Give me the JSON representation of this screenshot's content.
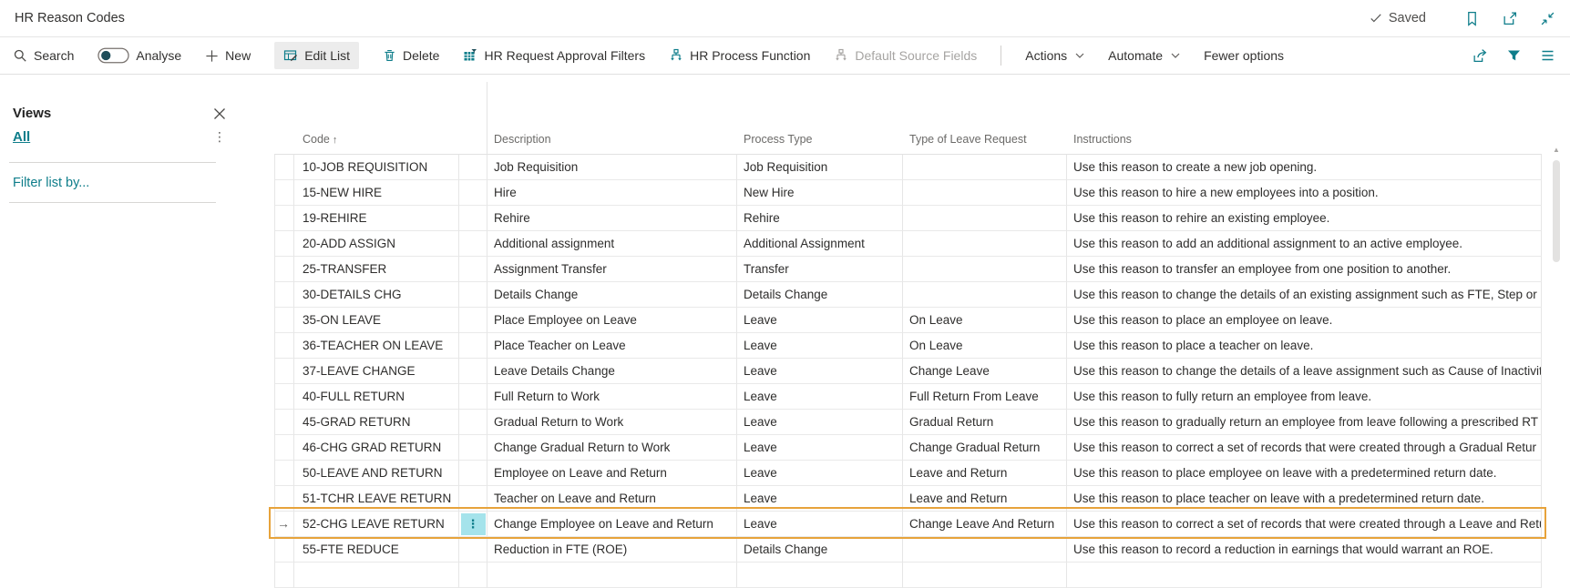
{
  "title_bar": {
    "title": "HR Reason Codes",
    "saved_label": "Saved"
  },
  "toolbar": {
    "search_label": "Search",
    "analyse_label": "Analyse",
    "new_label": "New",
    "edit_list_label": "Edit List",
    "delete_label": "Delete",
    "hr_request_approval_filters_label": "HR Request Approval Filters",
    "hr_process_function_label": "HR Process Function",
    "default_source_fields_label": "Default Source Fields",
    "actions_label": "Actions",
    "automate_label": "Automate",
    "fewer_options_label": "Fewer options"
  },
  "sidebar": {
    "views_label": "Views",
    "all_label": "All",
    "filter_label": "Filter list by..."
  },
  "grid": {
    "columns": [
      "Code",
      "Description",
      "Process Type",
      "Type of Leave Request",
      "Instructions"
    ],
    "sort_indicator": "↑",
    "selected_index": 14,
    "rows": [
      {
        "code": "10-JOB REQUISITION",
        "description": "Job Requisition",
        "process_type": "Job Requisition",
        "leave_type": "",
        "instructions": "Use this reason to create a new job opening."
      },
      {
        "code": "15-NEW HIRE",
        "description": "Hire",
        "process_type": "New Hire",
        "leave_type": "",
        "instructions": "Use this reason to hire a new employees into a position."
      },
      {
        "code": "19-REHIRE",
        "description": "Rehire",
        "process_type": "Rehire",
        "leave_type": "",
        "instructions": "Use this reason to rehire an existing employee."
      },
      {
        "code": "20-ADD ASSIGN",
        "description": "Additional assignment",
        "process_type": "Additional Assignment",
        "leave_type": "",
        "instructions": "Use this reason to add an additional assignment to an active employee."
      },
      {
        "code": "25-TRANSFER",
        "description": "Assignment Transfer",
        "process_type": "Transfer",
        "leave_type": "",
        "instructions": "Use this reason to transfer an employee from one position to another."
      },
      {
        "code": "30-DETAILS CHG",
        "description": "Details Change",
        "process_type": "Details Change",
        "leave_type": "",
        "instructions": "Use this reason to change the details of an existing assignment such as FTE, Step or G"
      },
      {
        "code": "35-ON LEAVE",
        "description": "Place Employee on Leave",
        "process_type": "Leave",
        "leave_type": "On Leave",
        "instructions": "Use this reason to place an employee on leave."
      },
      {
        "code": "36-TEACHER ON LEAVE",
        "description": "Place Teacher on Leave",
        "process_type": "Leave",
        "leave_type": "On Leave",
        "instructions": "Use this reason to place a teacher on leave."
      },
      {
        "code": "37-LEAVE CHANGE",
        "description": "Leave Details Change",
        "process_type": "Leave",
        "leave_type": "Change Leave",
        "instructions": "Use this reason to change the details of a leave assignment such as Cause of Inactivity"
      },
      {
        "code": "40-FULL RETURN",
        "description": "Full Return to Work",
        "process_type": "Leave",
        "leave_type": "Full Return From Leave",
        "instructions": "Use this reason to fully return an employee from leave."
      },
      {
        "code": "45-GRAD RETURN",
        "description": "Gradual Return to Work",
        "process_type": "Leave",
        "leave_type": "Gradual Return",
        "instructions": "Use this reason to gradually return an employee from leave following a prescribed RT"
      },
      {
        "code": "46-CHG GRAD RETURN",
        "description": "Change Gradual Return to Work",
        "process_type": "Leave",
        "leave_type": "Change Gradual Return",
        "instructions": "Use this reason to correct a set of records that were created through a Gradual Retur"
      },
      {
        "code": "50-LEAVE AND RETURN",
        "description": "Employee on Leave and Return",
        "process_type": "Leave",
        "leave_type": "Leave and Return",
        "instructions": "Use this reason to place employee on leave with a predetermined return date."
      },
      {
        "code": "51-TCHR LEAVE RETURN",
        "description": "Teacher on Leave and Return",
        "process_type": "Leave",
        "leave_type": "Leave and Return",
        "instructions": "Use this reason to place teacher on leave with a predetermined return date."
      },
      {
        "code": "52-CHG LEAVE RETURN",
        "description": "Change Employee on Leave and Return",
        "process_type": "Leave",
        "leave_type": "Change Leave And Return",
        "instructions": "Use this reason to correct a set of records that were created through a Leave and Retu"
      },
      {
        "code": "55-FTE REDUCE",
        "description": "Reduction in FTE (ROE)",
        "process_type": "Details Change",
        "leave_type": "",
        "instructions": "Use this reason to record a reduction in earnings that would warrant an ROE."
      }
    ]
  },
  "colors": {
    "accent_teal": "#0e7d8a",
    "selection_border_orange": "#e7a33b",
    "row_menu_cell_cyan": "#a5e3eb",
    "active_command_bg": "#ececec",
    "grid_border": "#e6e6e6",
    "text": "#323130",
    "muted_text": "#6b6a68",
    "disabled_text": "#a6a4a2"
  },
  "icons": {
    "search": "magnifier",
    "analyse_toggle": "toggle-off",
    "new": "plus",
    "edit_list": "table-pencil",
    "delete": "trash",
    "hr_request_approval_filters": "filtered-grid",
    "hr_process_function": "workflow",
    "default_source_fields": "workflow",
    "actions_chevron": "chevron-down",
    "automate_chevron": "chevron-down",
    "share": "share-arrow",
    "filter": "funnel",
    "choose_columns": "list-lines",
    "saved_check": "checkmark",
    "bookmark": "bookmark",
    "open_in_window": "popout",
    "collapse": "inward-arrows",
    "close_views": "x",
    "view_options": "ellipsis-vertical",
    "row_menu": "ellipsis-vertical",
    "selected_row": "arrow-right",
    "scroll_up": "triangle-up"
  }
}
